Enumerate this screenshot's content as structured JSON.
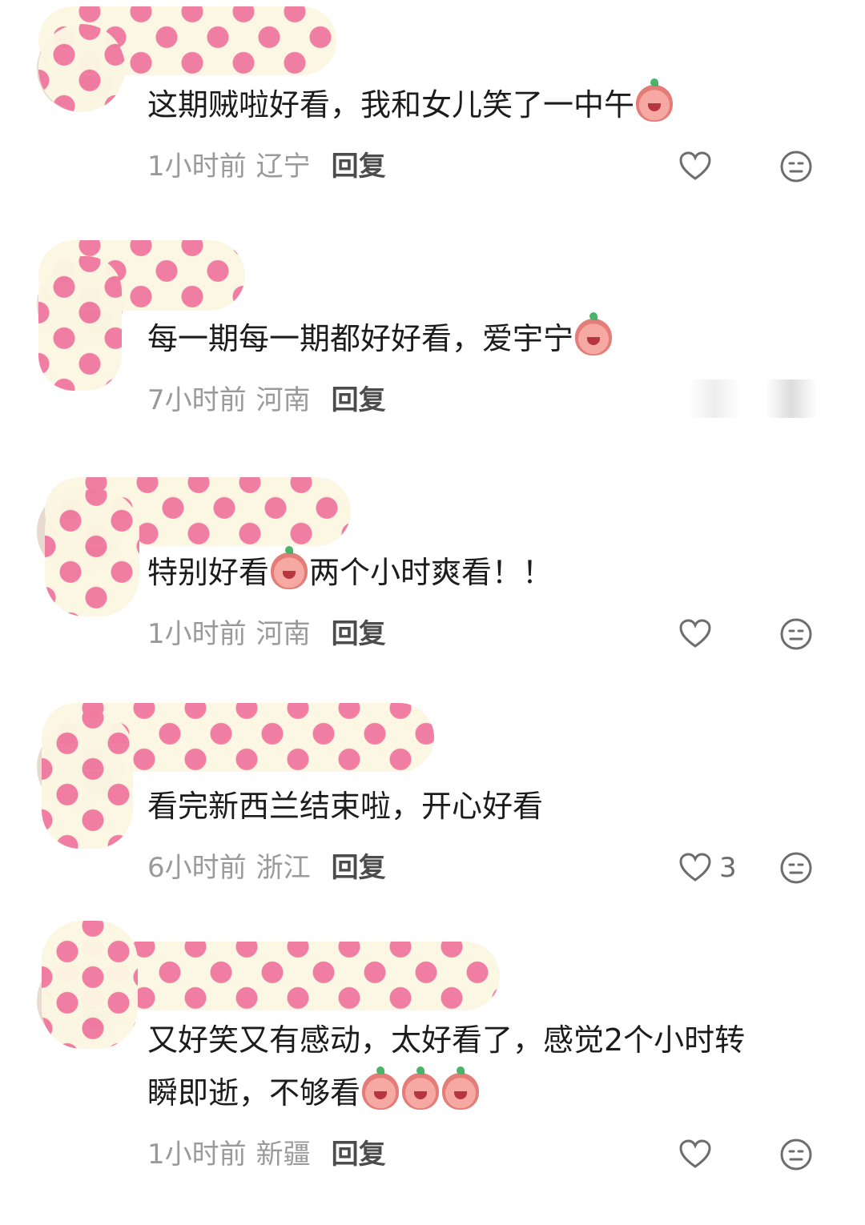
{
  "comments": [
    {
      "text": "这期贼啦好看，我和女儿笑了一中午",
      "emojis": [
        "cry-laugh-emoji"
      ],
      "time": "1小时前",
      "region": "辽宁",
      "reply": "回复",
      "likes": ""
    },
    {
      "text": "每一期每一期都好好看，爱宇宁",
      "emojis": [
        "kiss-emoji"
      ],
      "time": "7小时前",
      "region": "河南",
      "reply": "回复",
      "likes": ""
    },
    {
      "text_pre": "特别好看",
      "text_post": "两个小时爽看！！",
      "emojis": [
        "laugh-emoji"
      ],
      "time": "1小时前",
      "region": "河南",
      "reply": "回复",
      "likes": ""
    },
    {
      "text": "看完新西兰结束啦，开心好看",
      "time": "6小时前",
      "region": "浙江",
      "reply": "回复",
      "likes": "3"
    },
    {
      "text_line1": "又好笑又有感动，太好看了，感觉2个小时转",
      "text_line2": "瞬即逝，不够看",
      "emojis": [
        "cry-emoji",
        "cry-emoji",
        "cry-emoji"
      ],
      "time": "1小时前",
      "region": "新疆",
      "reply": "回复",
      "likes": ""
    }
  ],
  "colors": {
    "cover_bg": "#fcf7e3",
    "heart_pattern": "#f07aa0",
    "meta_gray": "#9a9a9a",
    "body_text": "#1c1c1c"
  }
}
